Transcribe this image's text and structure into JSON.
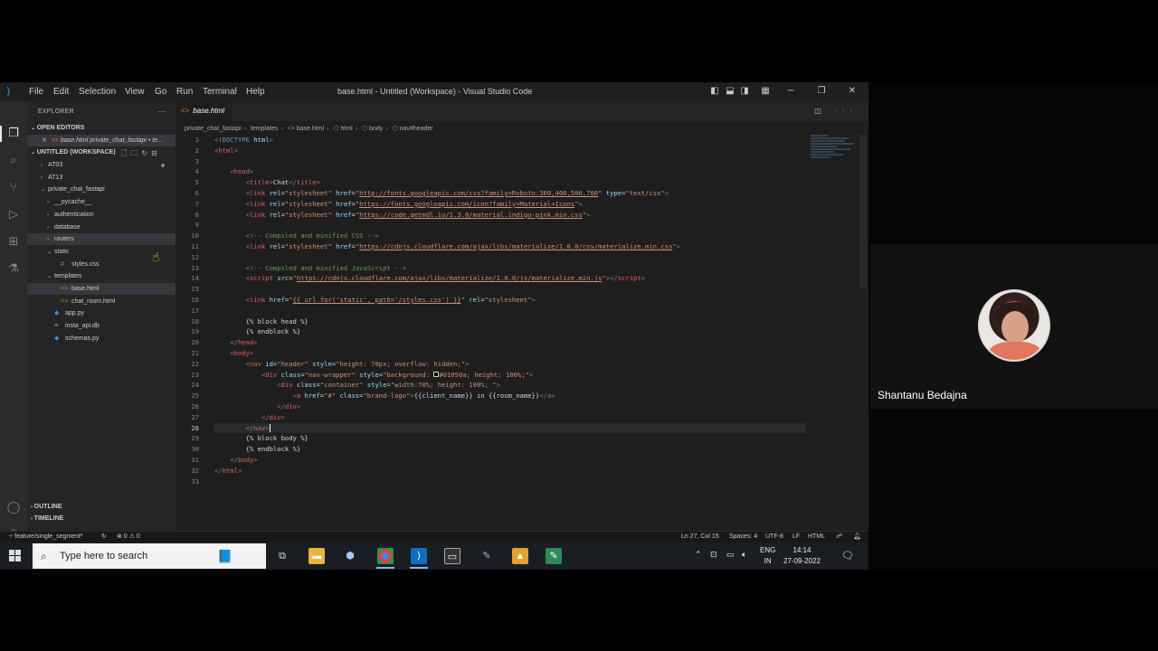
{
  "window": {
    "title": "base.html - Untitled (Workspace) - Visual Studio Code",
    "menu": [
      "File",
      "Edit",
      "Selection",
      "View",
      "Go",
      "Run",
      "Terminal",
      "Help"
    ]
  },
  "sidebar": {
    "header": "EXPLORER",
    "open_editors_label": "OPEN EDITORS",
    "open_editor": "base.html  private_chat_fastapi • te...",
    "workspace_label": "UNTITLED (WORKSPACE)",
    "tree": [
      {
        "label": "AT03",
        "indent": 1,
        "chev": "›",
        "icon": ""
      },
      {
        "label": "AT13",
        "indent": 1,
        "chev": "›",
        "icon": ""
      },
      {
        "label": "private_chat_fastapi",
        "indent": 1,
        "chev": "⌄",
        "icon": ""
      },
      {
        "label": "__pycache__",
        "indent": 2,
        "chev": "›",
        "icon": ""
      },
      {
        "label": "authentication",
        "indent": 2,
        "chev": "›",
        "icon": ""
      },
      {
        "label": "database",
        "indent": 2,
        "chev": "›",
        "icon": ""
      },
      {
        "label": "routers",
        "indent": 2,
        "chev": "›",
        "icon": "",
        "selected": true
      },
      {
        "label": "static",
        "indent": 2,
        "chev": "⌄",
        "icon": ""
      },
      {
        "label": "styles.css",
        "indent": 3,
        "chev": "",
        "icon": "#"
      },
      {
        "label": "templates",
        "indent": 2,
        "chev": "⌄",
        "icon": ""
      },
      {
        "label": "base.html",
        "indent": 3,
        "chev": "",
        "icon": "<>",
        "selected": true
      },
      {
        "label": "chat_room.html",
        "indent": 3,
        "chev": "",
        "icon": "<>"
      },
      {
        "label": "app.py",
        "indent": 2,
        "chev": "",
        "icon": "◆"
      },
      {
        "label": "insta_api.db",
        "indent": 2,
        "chev": "",
        "icon": "≡"
      },
      {
        "label": "schemas.py",
        "indent": 2,
        "chev": "",
        "icon": "◆"
      }
    ],
    "outline_label": "OUTLINE",
    "timeline_label": "TIMELINE"
  },
  "editor": {
    "tab_label": "base.html",
    "breadcrumb": [
      "private_chat_fastapi",
      "templates",
      "base.html",
      "html",
      "body",
      "nav#header"
    ],
    "current_line": 27
  },
  "status": {
    "branch": "feature/single_segment*",
    "problems": "⊗ 0 ⚠ 0",
    "position": "Ln 27, Col 15",
    "spaces": "Spaces: 4",
    "encoding": "UTF-8",
    "eol": "LF",
    "language": "HTML"
  },
  "taskbar": {
    "search_placeholder": "Type here to search",
    "lang_top": "ENG",
    "lang_bottom": "IN",
    "time": "14:14",
    "date": "27-09-2022"
  },
  "participant": {
    "name": "Shantanu Bedajna"
  },
  "colors": {
    "editor_bg": "#1e1e1e",
    "sidebar_bg": "#252526",
    "tag": "#569cd6",
    "attr": "#9cdcfe",
    "string": "#ce9178",
    "comment": "#6a9955"
  }
}
